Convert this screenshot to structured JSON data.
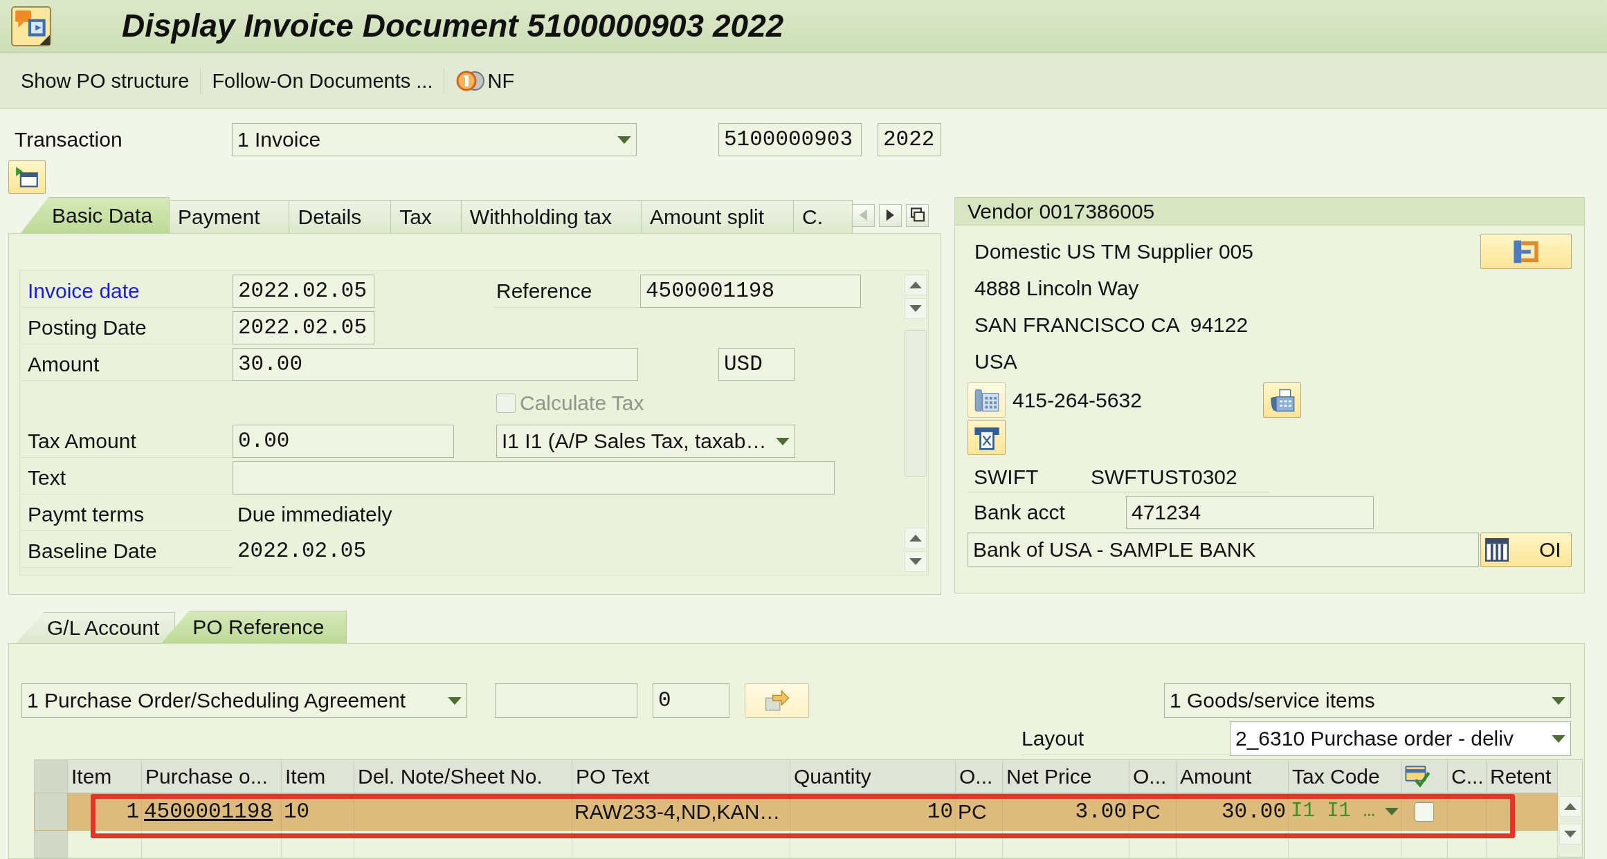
{
  "window": {
    "title": "Display Invoice Document 5100000903 2022"
  },
  "toolbar": [
    {
      "label": "Show PO structure",
      "kind": "text"
    },
    {
      "label": "Follow-On Documents ...",
      "kind": "text"
    },
    {
      "label": "NF",
      "kind": "icon"
    }
  ],
  "header": {
    "transaction_label": "Transaction",
    "transaction": "1 Invoice",
    "document_number": "5100000903",
    "fiscal_year": "2022"
  },
  "tabs": [
    {
      "label": "Basic Data",
      "selected": true
    },
    {
      "label": "Payment",
      "selected": false
    },
    {
      "label": "Details",
      "selected": false
    },
    {
      "label": "Tax",
      "selected": false
    },
    {
      "label": "Withholding tax",
      "selected": false
    },
    {
      "label": "Amount split",
      "selected": false
    },
    {
      "label": "C.",
      "selected": false
    }
  ],
  "tab_scroll": [
    {
      "kind": "left",
      "disabled": true
    },
    {
      "kind": "right",
      "disabled": false
    },
    {
      "kind": "list",
      "disabled": false
    }
  ],
  "basic_data": {
    "invoice_date": {
      "label": "Invoice date",
      "value": "2022.02.05",
      "link": true
    },
    "reference": {
      "label": "Reference",
      "value": "4500001198"
    },
    "posting_date": {
      "label": "Posting Date",
      "value": "2022.02.05"
    },
    "amount": {
      "label": "Amount",
      "value": "30.00",
      "currency": "USD"
    },
    "calculate_tax": {
      "label": "Calculate Tax",
      "checked": false,
      "disabled": true
    },
    "tax_amount": {
      "label": "Tax Amount",
      "value": "0.00",
      "tax_code": "I1 I1 (A/P Sales Tax, taxab…"
    },
    "text": {
      "label": "Text"
    },
    "payment_terms": {
      "label": "Paymt terms",
      "value": "Due immediately"
    },
    "baseline_date": {
      "label": "Baseline Date",
      "value": "2022.02.05"
    }
  },
  "vendor": {
    "title": "Vendor 0017386005",
    "name": "Domestic US TM Supplier 005",
    "street": "4888 Lincoln Way",
    "city": "SAN FRANCISCO CA  94122",
    "country": "USA",
    "phone": "415-264-5632",
    "swift_label": "SWIFT",
    "swift": "SWFTUST0302",
    "bank_acct_label": "Bank acct",
    "bank_acct": "471234",
    "bank_name": "Bank of USA - SAMPLE BANK",
    "open_items_button": "OI"
  },
  "lower_tabs": [
    {
      "label": "G/L Account",
      "selected": false
    },
    {
      "label": "PO Reference",
      "selected": true
    }
  ],
  "po_reference": {
    "document_type": "1 Purchase Order/Scheduling Agreement",
    "po_item": "0",
    "item_category": "1 Goods/service items",
    "layout_label": "Layout",
    "layout": "2_6310 Purchase order - deliv"
  },
  "po_table": {
    "columns": [
      {
        "label": "Item",
        "kind": "number"
      },
      {
        "label": "Purchase o...",
        "kind": "link"
      },
      {
        "label": "Item",
        "kind": "mono"
      },
      {
        "label": "Del. Note/Sheet No.",
        "kind": "text"
      },
      {
        "label": "PO Text",
        "kind": "text"
      },
      {
        "label": "Quantity",
        "kind": "number"
      },
      {
        "label": "O...",
        "kind": "text"
      },
      {
        "label": "Net Price",
        "kind": "number"
      },
      {
        "label": "O...",
        "kind": "text"
      },
      {
        "label": "Amount",
        "kind": "number"
      },
      {
        "label": "Tax Code",
        "kind": "dropdown"
      },
      {
        "kind": "checkbox"
      },
      {
        "label": "C...",
        "kind": "text"
      },
      {
        "label": "Retent",
        "kind": "text"
      }
    ],
    "rows": [
      {
        "highlighted": true,
        "framed": true,
        "cells": [
          {
            "text": "1"
          },
          {
            "text": "4500001198"
          },
          {
            "text": "10"
          },
          {},
          {
            "text": "RAW233-4,ND,KAN…"
          },
          {
            "text": "10"
          },
          {
            "text": "PC"
          },
          {
            "text": "3.00"
          },
          {
            "text": "PC"
          },
          {
            "text": "30.00"
          },
          {
            "text": "I1 I1 …"
          },
          {
            "checked": false
          },
          {},
          {}
        ]
      }
    ]
  }
}
